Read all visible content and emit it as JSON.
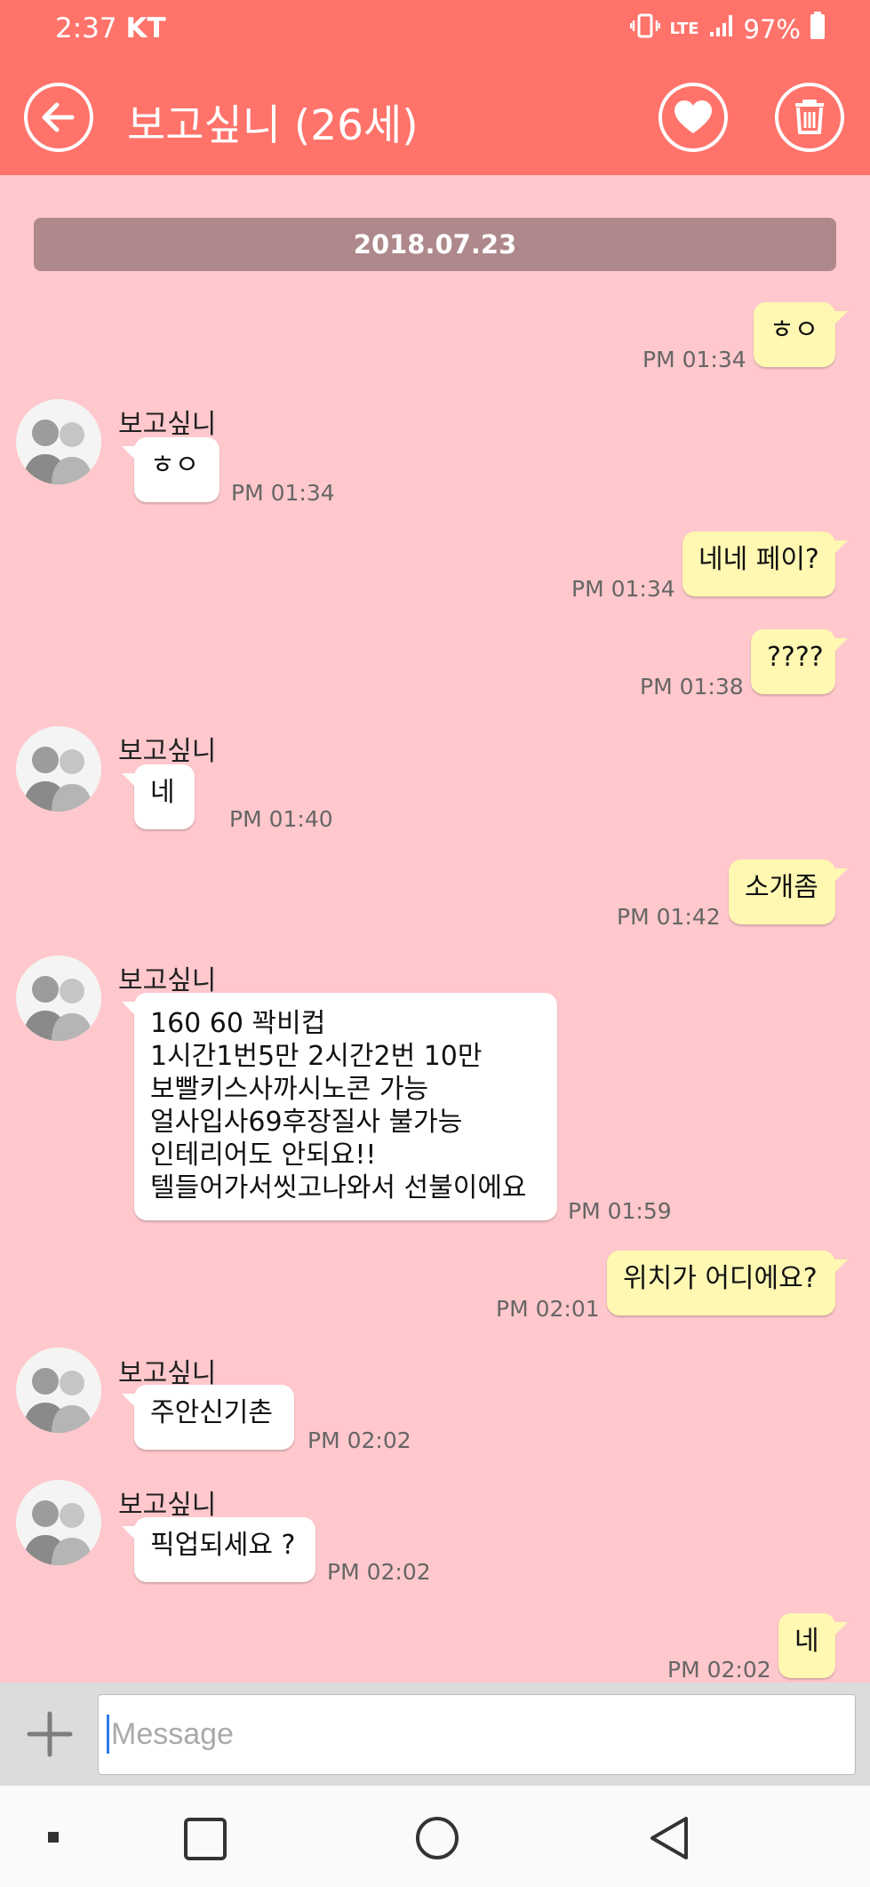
{
  "status_bar": {
    "time": "2:37",
    "carrier": "KT",
    "network": "LTE",
    "battery": "97%"
  },
  "header": {
    "title": "보고싶니 (26세)"
  },
  "chat": {
    "date": "2018.07.23",
    "messages": [
      {
        "side": "out",
        "text": "ㅎㅇ",
        "time": "PM 01:34"
      },
      {
        "side": "in",
        "sender": "보고싶니",
        "text": "ㅎㅇ",
        "time": "PM 01:34"
      },
      {
        "side": "out",
        "text": "네네 페이?",
        "time": "PM 01:34"
      },
      {
        "side": "out",
        "text": "????",
        "time": "PM 01:38"
      },
      {
        "side": "in",
        "sender": "보고싶니",
        "text": "네",
        "time": "PM 01:40"
      },
      {
        "side": "out",
        "text": "소개좀",
        "time": "PM 01:42"
      },
      {
        "side": "in",
        "sender": "보고싶니",
        "lines": [
          "160 60 꽉비컵",
          "1시간1번5만 2시간2번 10만",
          "보빨키스사까시노콘 가능",
          "얼사입사69후장질사 불가능",
          "인테리어도 안되요!!",
          "텔들어가서씻고나와서 선불이에요"
        ],
        "time": "PM 01:59"
      },
      {
        "side": "out",
        "text": "위치가 어디에요?",
        "time": "PM 02:01"
      },
      {
        "side": "in",
        "sender": "보고싶니",
        "text": "주안신기촌",
        "time": "PM 02:02"
      },
      {
        "side": "in",
        "sender": "보고싶니",
        "text": "픽업되세요 ?",
        "time": "PM 02:02"
      },
      {
        "side": "out",
        "text": "네",
        "time": "PM 02:02"
      }
    ]
  },
  "input": {
    "placeholder": "Message"
  },
  "colors": {
    "header": "#ff736b",
    "background": "#ffc8cc",
    "outgoing_bubble": "#fff8b2",
    "incoming_bubble": "#ffffff",
    "date_separator": "#ae888b"
  },
  "icons": {
    "back": "arrow-left-circle",
    "favorite": "heart-circle",
    "delete": "trash-circle",
    "attach": "plus",
    "nav_recent": "square",
    "nav_home": "circle",
    "nav_back": "triangle"
  }
}
